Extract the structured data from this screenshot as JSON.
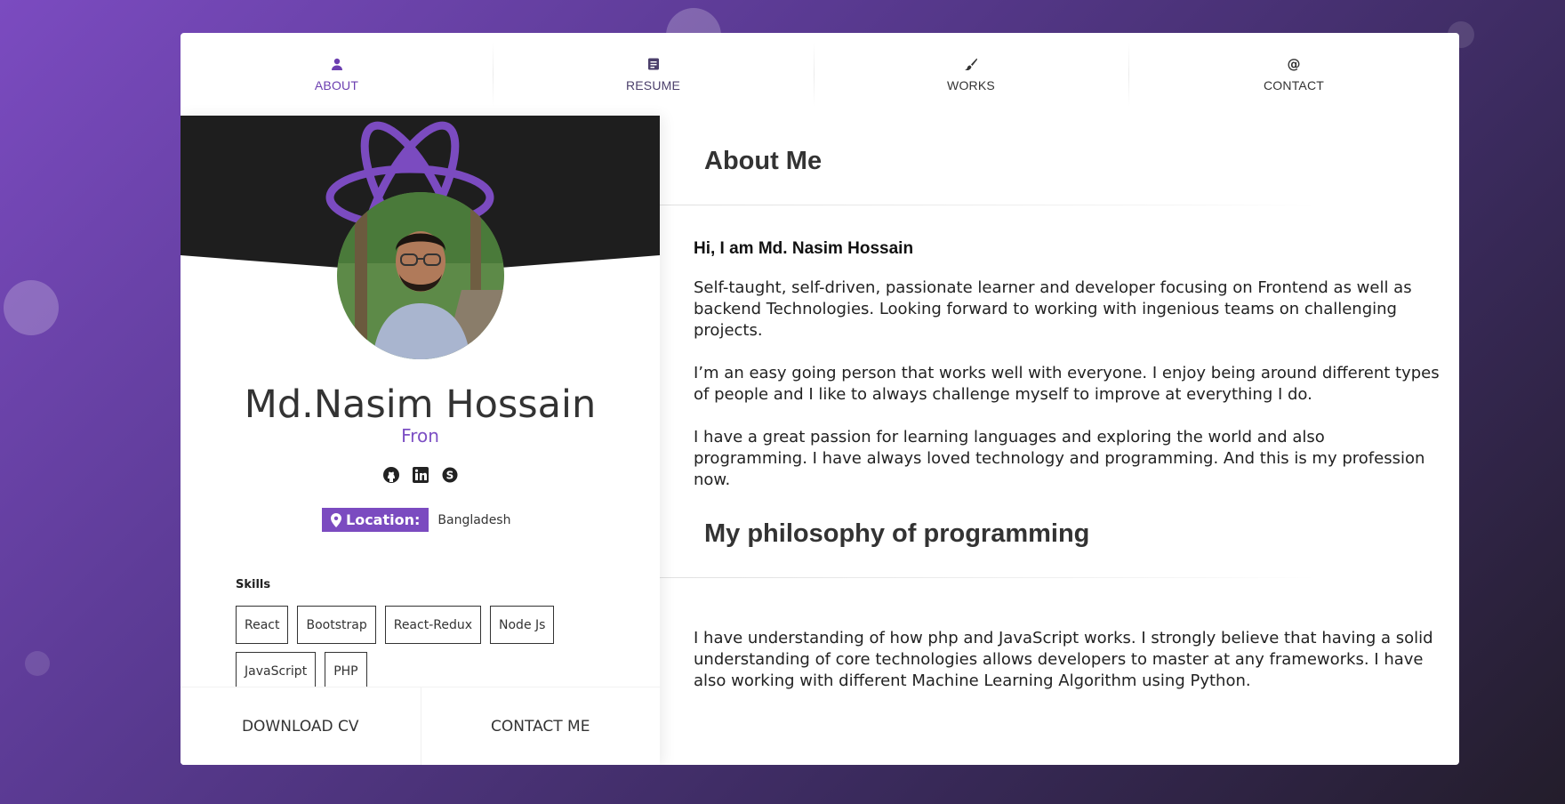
{
  "nav": {
    "about": "ABOUT",
    "resume": "RESUME",
    "works": "WORKS",
    "contact": "CONTACT"
  },
  "profile": {
    "name": "Md.Nasim Hossain",
    "role": "Fron",
    "location_label": "Location:",
    "location_value": "Bangladesh",
    "skills_title": "Skills",
    "skills": [
      "React",
      "Bootstrap",
      "React-Redux",
      "Node Js",
      "JavaScript",
      "PHP"
    ],
    "download_cv": "DOWNLOAD CV",
    "contact_me": "CONTACT ME"
  },
  "about": {
    "title": "About Me",
    "greeting": "Hi, I am Md. Nasim Hossain",
    "paragraphs": [
      "Self-taught, self-driven, passionate learner and developer focusing on Frontend as well as backend Technologies. Looking forward to working with ingenious teams on challenging projects.",
      "I’m an easy going person that works well with everyone. I enjoy being around different types of people and I like to always challenge myself to improve at everything I do.",
      "I have a great passion for learning languages and exploring the world and also programming. I have always loved technology and programming. And this is my profession now."
    ]
  },
  "philosophy": {
    "title": "My philosophy of programming",
    "paragraph": "I have understanding of how php and JavaScript works. I strongly believe that having a solid understanding of core technologies allows developers to master at any frameworks. I have also working with different Machine Learning Algorithm using Python."
  },
  "colors": {
    "accent": "#7b4bc0",
    "header_dark": "#1e1e1e"
  }
}
